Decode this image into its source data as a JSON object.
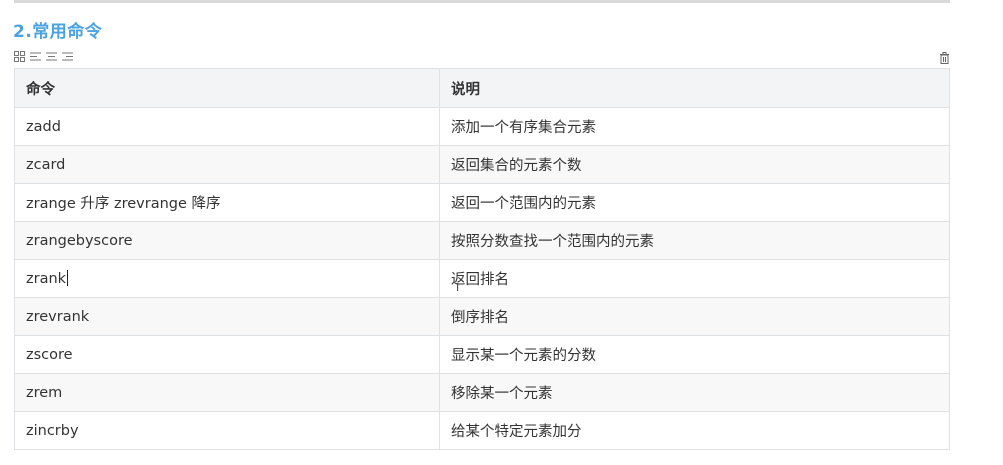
{
  "section": {
    "heading": "2.常用命令"
  },
  "toolbar": {
    "icons": [
      "grid-icon",
      "align-left-icon",
      "align-center-icon",
      "align-right-icon"
    ],
    "delete_icon": "trash-icon"
  },
  "table": {
    "headers": [
      "命令",
      "说明"
    ],
    "rows": [
      {
        "command": "zadd",
        "description": "添加一个有序集合元素"
      },
      {
        "command": "zcard",
        "description": "返回集合的元素个数"
      },
      {
        "command": "zrange 升序 zrevrange 降序",
        "description": "返回一个范围内的元素"
      },
      {
        "command": "zrangebyscore",
        "description": "按照分数查找一个范围内的元素"
      },
      {
        "command": "zrank",
        "description": "返回排名"
      },
      {
        "command": "zrevrank",
        "description": "倒序排名"
      },
      {
        "command": "zscore",
        "description": "显示某一个元素的分数"
      },
      {
        "command": "zrem",
        "description": "移除某一个元素"
      },
      {
        "command": "zincrby",
        "description": "给某个特定元素加分"
      }
    ]
  },
  "colors": {
    "heading": "#4aa3df",
    "header_bg": "#f3f4f6",
    "stripe_bg": "#f8f8f8",
    "border": "#dfe2e5"
  }
}
